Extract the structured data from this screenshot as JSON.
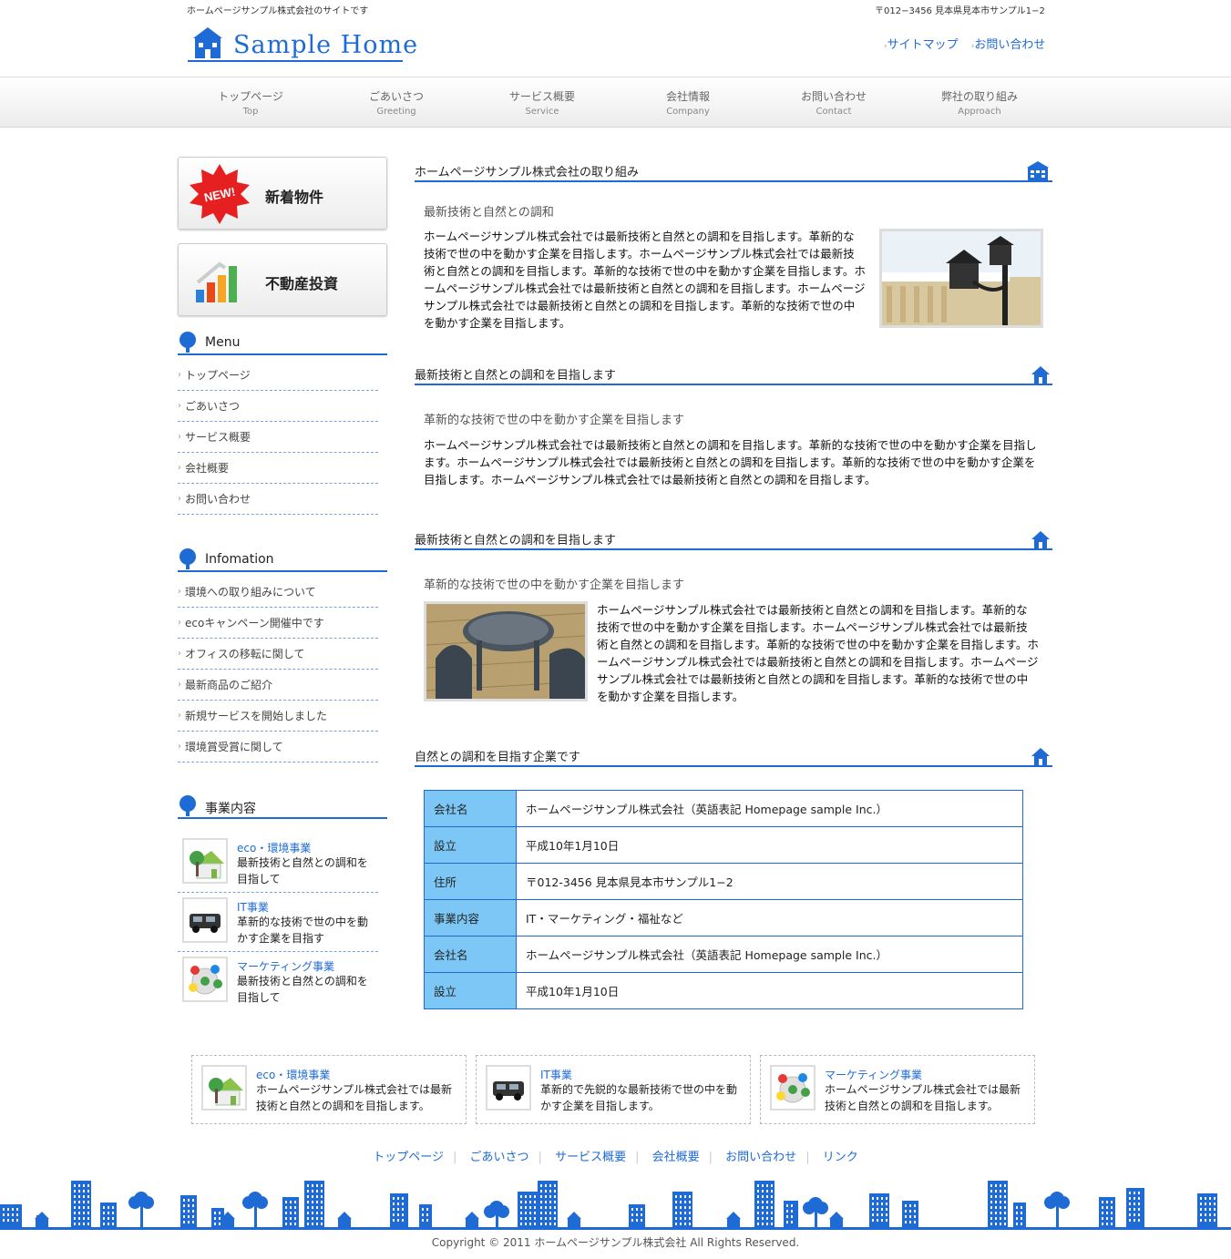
{
  "header": {
    "tagline": "ホームページサンプル株式会社のサイトです",
    "address": "〒012−3456 見本県見本市サンプル1−2",
    "logo_text": "Sample Home",
    "links": [
      "サイトマップ",
      "お問い合わせ"
    ]
  },
  "nav": [
    {
      "jp": "トップページ",
      "en": "Top"
    },
    {
      "jp": "ごあいさつ",
      "en": "Greeting"
    },
    {
      "jp": "サービス概要",
      "en": "Service"
    },
    {
      "jp": "会社情報",
      "en": "Company"
    },
    {
      "jp": "お問い合わせ",
      "en": "Contact"
    },
    {
      "jp": "弊社の取り組み",
      "en": "Approach"
    }
  ],
  "sidebar": {
    "banners": [
      {
        "label": "新着物件",
        "badge": "NEW!"
      },
      {
        "label": "不動産投資"
      }
    ],
    "menu": {
      "title": "Menu",
      "items": [
        "トップページ",
        "ごあいさつ",
        "サービス概要",
        "会社概要",
        "お問い合わせ"
      ]
    },
    "info": {
      "title": "Infomation",
      "items": [
        "環境への取り組みについて",
        "ecoキャンペーン開催中です",
        "オフィスの移転に関して",
        "最新商品のご紹介",
        "新規サービスを開始しました",
        "環境賞受賞に関して"
      ]
    },
    "business": {
      "title": "事業内容",
      "items": [
        {
          "title": "eco・環境事業",
          "desc": "最新技術と自然との調和を目指して"
        },
        {
          "title": "IT事業",
          "desc": "革新的な技術で世の中を動かす企業を目指す"
        },
        {
          "title": "マーケティング事業",
          "desc": "最新技術と自然との調和を目指して"
        }
      ]
    }
  },
  "main": {
    "sections": [
      {
        "heading": "ホームページサンプル株式会社の取り組み",
        "subheading": "最新技術と自然との調和",
        "text": "ホームページサンプル株式会社では最新技術と自然との調和を目指します。革新的な技術で世の中を動かす企業を目指します。ホームページサンプル株式会社では最新技術と自然との調和を目指します。革新的な技術で世の中を動かす企業を目指します。ホームページサンプル株式会社では最新技術と自然との調和を目指します。ホームページサンプル株式会社では最新技術と自然との調和を目指します。革新的な技術で世の中を動かす企業を目指します。"
      },
      {
        "heading": "最新技術と自然との調和を目指します",
        "subheading": "革新的な技術で世の中を動かす企業を目指します",
        "text": "ホームページサンプル株式会社では最新技術と自然との調和を目指します。革新的な技術で世の中を動かす企業を目指します。ホームページサンプル株式会社では最新技術と自然との調和を目指します。革新的な技術で世の中を動かす企業を目指します。ホームページサンプル株式会社では最新技術と自然との調和を目指します。"
      },
      {
        "heading": "最新技術と自然との調和を目指します",
        "subheading": "革新的な技術で世の中を動かす企業を目指します",
        "text": "ホームページサンプル株式会社では最新技術と自然との調和を目指します。革新的な技術で世の中を動かす企業を目指します。ホームページサンプル株式会社では最新技術と自然との調和を目指します。革新的な技術で世の中を動かす企業を目指します。ホームページサンプル株式会社では最新技術と自然との調和を目指します。ホームページサンプル株式会社では最新技術と自然との調和を目指します。革新的な技術で世の中を動かす企業を目指します。"
      },
      {
        "heading": "自然との調和を目指す企業です"
      }
    ],
    "table": [
      {
        "label": "会社名",
        "value": "ホームページサンプル株式会社（英語表記 Homepage sample Inc.）"
      },
      {
        "label": "設立",
        "value": "平成10年1月10日"
      },
      {
        "label": "住所",
        "value": "〒012-3456 見本県見本市サンプル1−2"
      },
      {
        "label": "事業内容",
        "value": "IT・マーケティング・福祉など"
      },
      {
        "label": "会社名",
        "value": "ホームページサンプル株式会社（英語表記 Homepage sample Inc.）"
      },
      {
        "label": "設立",
        "value": "平成10年1月10日"
      }
    ]
  },
  "footer": {
    "boxes": [
      {
        "title": "eco・環境事業",
        "desc": "ホームページサンプル株式会社では最新技術と自然との調和を目指します。"
      },
      {
        "title": "IT事業",
        "desc": "革新的で先鋭的な最新技術で世の中を動かす企業を目指します。"
      },
      {
        "title": "マーケティング事業",
        "desc": "ホームページサンプル株式会社では最新技術と自然との調和を目指します。"
      }
    ],
    "links": [
      "トップページ",
      "ごあいさつ",
      "サービス概要",
      "会社概要",
      "お問い合わせ",
      "リンク"
    ],
    "copyright": "Copyright © 2011 ホームページサンプル株式会社 All Rights Reserved."
  },
  "colors": {
    "accent": "#1e6bd6",
    "table_header": "#7cc7f5"
  }
}
